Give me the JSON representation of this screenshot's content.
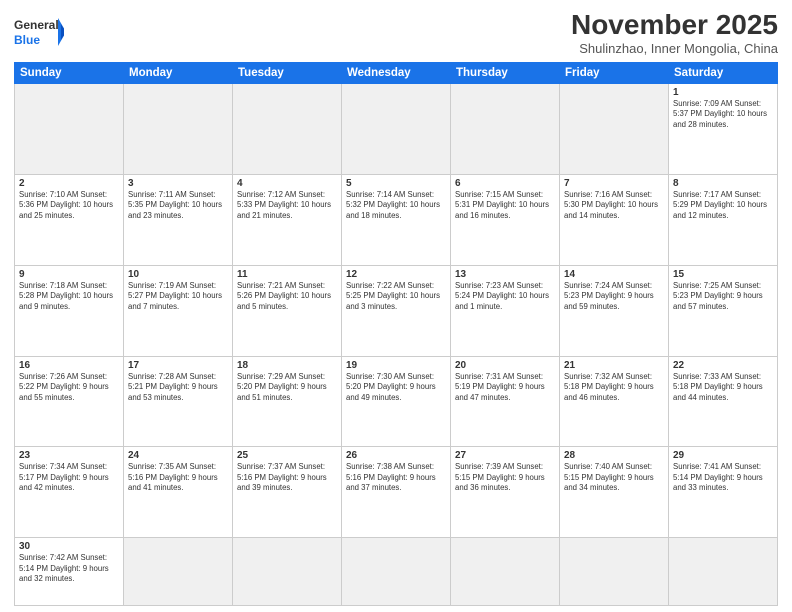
{
  "header": {
    "logo_general": "General",
    "logo_blue": "Blue",
    "month_title": "November 2025",
    "location": "Shulinzhao, Inner Mongolia, China"
  },
  "weekdays": [
    "Sunday",
    "Monday",
    "Tuesday",
    "Wednesday",
    "Thursday",
    "Friday",
    "Saturday"
  ],
  "weeks": [
    [
      {
        "day": "",
        "empty": true
      },
      {
        "day": "",
        "empty": true
      },
      {
        "day": "",
        "empty": true
      },
      {
        "day": "",
        "empty": true
      },
      {
        "day": "",
        "empty": true
      },
      {
        "day": "",
        "empty": true
      },
      {
        "day": "1",
        "info": "Sunrise: 7:09 AM\nSunset: 5:37 PM\nDaylight: 10 hours\nand 28 minutes."
      }
    ],
    [
      {
        "day": "2",
        "info": "Sunrise: 7:10 AM\nSunset: 5:36 PM\nDaylight: 10 hours\nand 25 minutes."
      },
      {
        "day": "3",
        "info": "Sunrise: 7:11 AM\nSunset: 5:35 PM\nDaylight: 10 hours\nand 23 minutes."
      },
      {
        "day": "4",
        "info": "Sunrise: 7:12 AM\nSunset: 5:33 PM\nDaylight: 10 hours\nand 21 minutes."
      },
      {
        "day": "5",
        "info": "Sunrise: 7:14 AM\nSunset: 5:32 PM\nDaylight: 10 hours\nand 18 minutes."
      },
      {
        "day": "6",
        "info": "Sunrise: 7:15 AM\nSunset: 5:31 PM\nDaylight: 10 hours\nand 16 minutes."
      },
      {
        "day": "7",
        "info": "Sunrise: 7:16 AM\nSunset: 5:30 PM\nDaylight: 10 hours\nand 14 minutes."
      },
      {
        "day": "8",
        "info": "Sunrise: 7:17 AM\nSunset: 5:29 PM\nDaylight: 10 hours\nand 12 minutes."
      }
    ],
    [
      {
        "day": "9",
        "info": "Sunrise: 7:18 AM\nSunset: 5:28 PM\nDaylight: 10 hours\nand 9 minutes."
      },
      {
        "day": "10",
        "info": "Sunrise: 7:19 AM\nSunset: 5:27 PM\nDaylight: 10 hours\nand 7 minutes."
      },
      {
        "day": "11",
        "info": "Sunrise: 7:21 AM\nSunset: 5:26 PM\nDaylight: 10 hours\nand 5 minutes."
      },
      {
        "day": "12",
        "info": "Sunrise: 7:22 AM\nSunset: 5:25 PM\nDaylight: 10 hours\nand 3 minutes."
      },
      {
        "day": "13",
        "info": "Sunrise: 7:23 AM\nSunset: 5:24 PM\nDaylight: 10 hours\nand 1 minute."
      },
      {
        "day": "14",
        "info": "Sunrise: 7:24 AM\nSunset: 5:23 PM\nDaylight: 9 hours\nand 59 minutes."
      },
      {
        "day": "15",
        "info": "Sunrise: 7:25 AM\nSunset: 5:23 PM\nDaylight: 9 hours\nand 57 minutes."
      }
    ],
    [
      {
        "day": "16",
        "info": "Sunrise: 7:26 AM\nSunset: 5:22 PM\nDaylight: 9 hours\nand 55 minutes."
      },
      {
        "day": "17",
        "info": "Sunrise: 7:28 AM\nSunset: 5:21 PM\nDaylight: 9 hours\nand 53 minutes."
      },
      {
        "day": "18",
        "info": "Sunrise: 7:29 AM\nSunset: 5:20 PM\nDaylight: 9 hours\nand 51 minutes."
      },
      {
        "day": "19",
        "info": "Sunrise: 7:30 AM\nSunset: 5:20 PM\nDaylight: 9 hours\nand 49 minutes."
      },
      {
        "day": "20",
        "info": "Sunrise: 7:31 AM\nSunset: 5:19 PM\nDaylight: 9 hours\nand 47 minutes."
      },
      {
        "day": "21",
        "info": "Sunrise: 7:32 AM\nSunset: 5:18 PM\nDaylight: 9 hours\nand 46 minutes."
      },
      {
        "day": "22",
        "info": "Sunrise: 7:33 AM\nSunset: 5:18 PM\nDaylight: 9 hours\nand 44 minutes."
      }
    ],
    [
      {
        "day": "23",
        "info": "Sunrise: 7:34 AM\nSunset: 5:17 PM\nDaylight: 9 hours\nand 42 minutes."
      },
      {
        "day": "24",
        "info": "Sunrise: 7:35 AM\nSunset: 5:16 PM\nDaylight: 9 hours\nand 41 minutes."
      },
      {
        "day": "25",
        "info": "Sunrise: 7:37 AM\nSunset: 5:16 PM\nDaylight: 9 hours\nand 39 minutes."
      },
      {
        "day": "26",
        "info": "Sunrise: 7:38 AM\nSunset: 5:16 PM\nDaylight: 9 hours\nand 37 minutes."
      },
      {
        "day": "27",
        "info": "Sunrise: 7:39 AM\nSunset: 5:15 PM\nDaylight: 9 hours\nand 36 minutes."
      },
      {
        "day": "28",
        "info": "Sunrise: 7:40 AM\nSunset: 5:15 PM\nDaylight: 9 hours\nand 34 minutes."
      },
      {
        "day": "29",
        "info": "Sunrise: 7:41 AM\nSunset: 5:14 PM\nDaylight: 9 hours\nand 33 minutes."
      }
    ],
    [
      {
        "day": "30",
        "info": "Sunrise: 7:42 AM\nSunset: 5:14 PM\nDaylight: 9 hours\nand 32 minutes."
      },
      {
        "day": "",
        "empty": true
      },
      {
        "day": "",
        "empty": true
      },
      {
        "day": "",
        "empty": true
      },
      {
        "day": "",
        "empty": true
      },
      {
        "day": "",
        "empty": true
      },
      {
        "day": "",
        "empty": true
      }
    ]
  ]
}
